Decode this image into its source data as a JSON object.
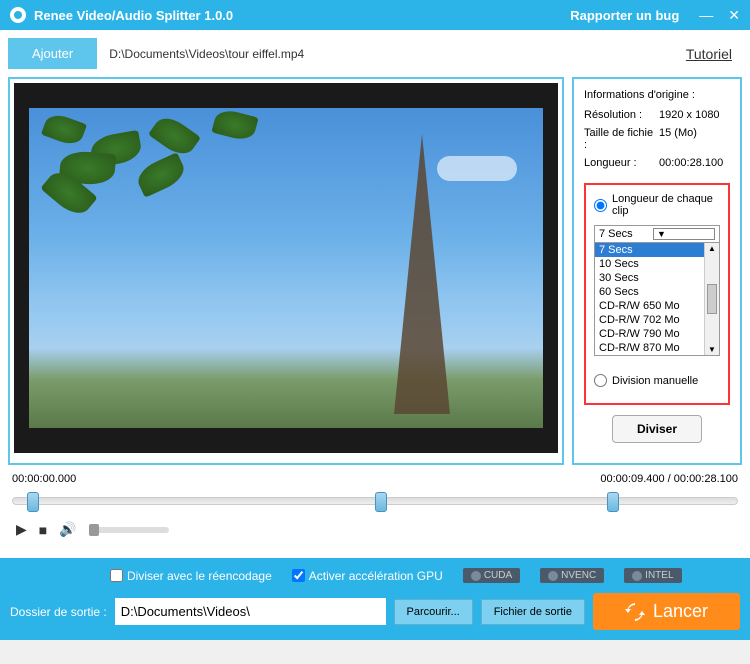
{
  "titlebar": {
    "title": "Renee Video/Audio Splitter 1.0.0",
    "report_bug": "Rapporter un bug"
  },
  "topbar": {
    "add_button": "Ajouter",
    "filepath": "D:\\Documents\\Videos\\tour eiffel.mp4",
    "tutorial": "Tutoriel"
  },
  "info": {
    "title": "Informations d'origine :",
    "resolution_label": "Résolution :",
    "resolution_value": "1920 x 1080",
    "filesize_label": "Taille de fichie :",
    "filesize_value": "15 (Mo)",
    "length_label": "Longueur :",
    "length_value": "00:00:28.100"
  },
  "split": {
    "clip_length_label": "Longueur de chaque clip",
    "selected": "7 Secs",
    "options": [
      "7 Secs",
      "10 Secs",
      "30 Secs",
      "60 Secs",
      "CD-R/W 650 Mo",
      "CD-R/W 702 Mo",
      "CD-R/W 790 Mo",
      "CD-R/W 870 Mo"
    ],
    "manual_label": "Division manuelle",
    "divide_button": "Diviser"
  },
  "timeline": {
    "start": "00:00:00.000",
    "position": "00:00:09.400 / 00:00:28.100"
  },
  "bottom": {
    "reencode_label": "Diviser avec le réencodage",
    "gpu_label": "Activer accélération GPU",
    "badges": [
      "CUDA",
      "NVENC",
      "INTEL"
    ],
    "output_label": "Dossier de sortie :",
    "output_path": "D:\\Documents\\Videos\\",
    "browse": "Parcourir...",
    "output_file": "Fichier de sortie",
    "launch": "Lancer"
  }
}
